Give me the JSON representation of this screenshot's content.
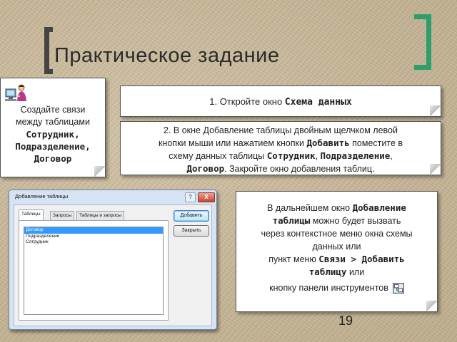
{
  "slide": {
    "title": "Практическое задание",
    "page_number": "19",
    "accent_color": "#2f9e6a"
  },
  "note1": {
    "line1": "Создайте связи",
    "line2": "между таблицами",
    "bold1": "Сотрудник,",
    "bold2": "Подразделение,",
    "bold3": "Договор"
  },
  "note2": {
    "prefix": "1. Откройте окно ",
    "bold": "Схема данных"
  },
  "note3": {
    "line1": "2. В окне Добавление таблицы двойным щелчком левой",
    "line2a": "кнопки мыши или нажатием кнопки ",
    "line2b": "Добавить",
    "line2c": " поместите в",
    "line3a": "схему данных таблицы ",
    "line3b": "Сотрудник",
    "line3c": ", ",
    "line3d": "Подразделение",
    "line3e": ",",
    "line4a": "Договор",
    "line4b": ". Закройте окно добавления таблиц."
  },
  "note4": {
    "line1a": "В дальнейшем окно ",
    "line1b": "Добавление",
    "line2a": "таблицы",
    "line2b": " можно будет вызвать",
    "line3": "через контекстное меню окна схемы",
    "line4": "данных или",
    "line5a": "пункт меню ",
    "line5b": "Связи > Добавить",
    "line6a": "таблицу",
    "line6b": " или",
    "line7": "кнопку панели инструментов"
  },
  "dialog": {
    "title": "Добавление таблицы",
    "help": "?",
    "close": "X",
    "tabs": [
      "Таблицы",
      "Запросы",
      "Таблицы и запросы"
    ],
    "items": [
      "Договор",
      "Подразделение",
      "Сотрудник"
    ],
    "add_button": "Добавить",
    "close_button": "Закрыть"
  }
}
